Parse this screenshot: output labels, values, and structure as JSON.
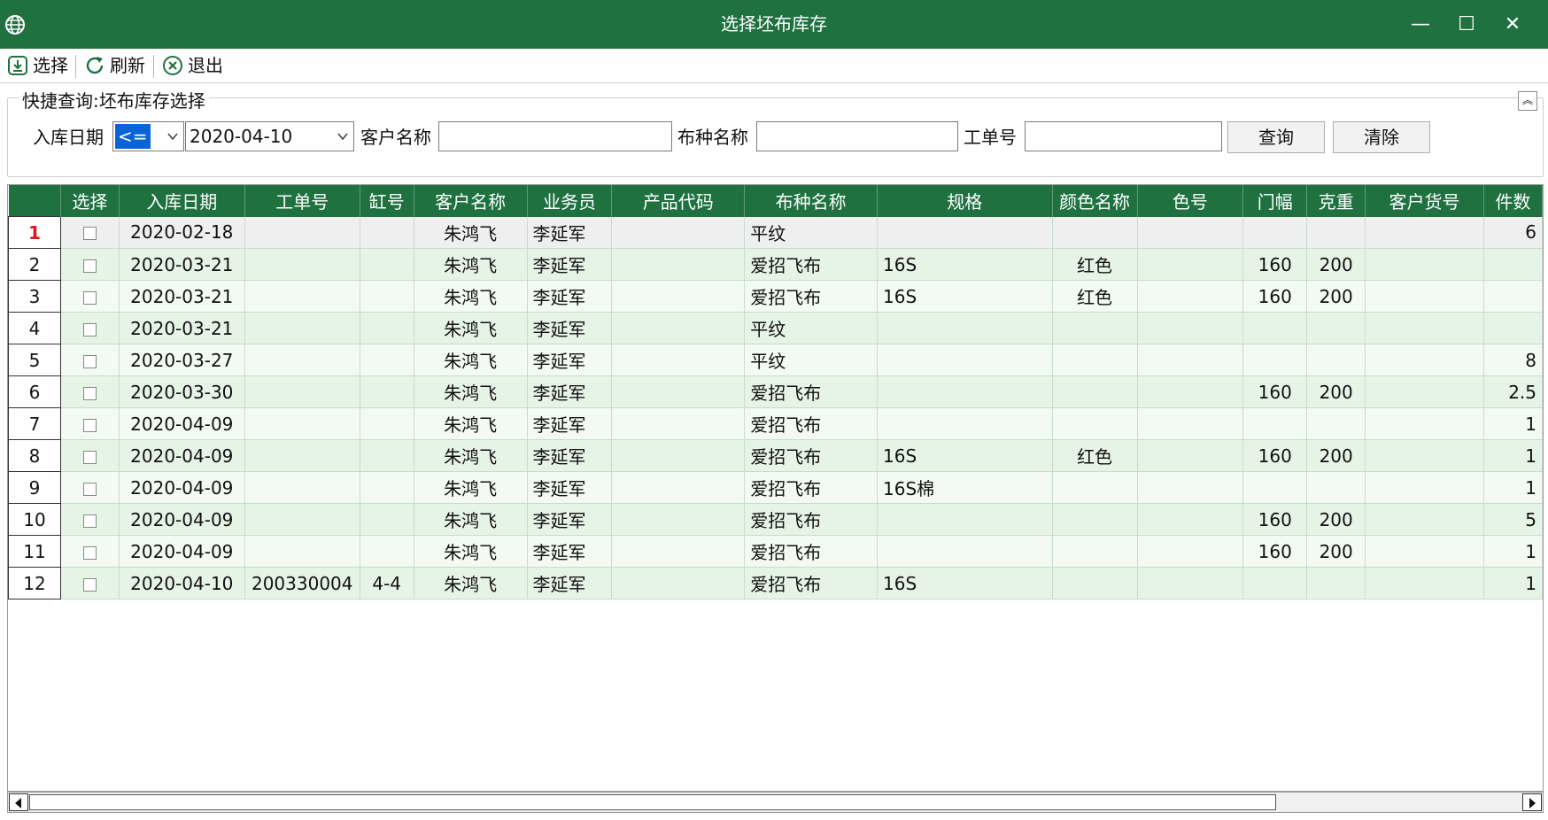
{
  "window": {
    "title": "选择坯布库存",
    "minimize": "—",
    "maximize": "☐",
    "close": "✕"
  },
  "toolbar": {
    "select_label": "选择",
    "refresh_label": "刷新",
    "exit_label": "退出"
  },
  "query": {
    "legend": "快捷查询:坯布库存选择",
    "date_label": "入库日期",
    "date_operator": "<=",
    "date_value": "2020-04-10",
    "customer_label": "客户名称",
    "customer_value": "",
    "fabric_label": "布种名称",
    "fabric_value": "",
    "order_label": "工单号",
    "order_value": "",
    "search_button": "查询",
    "clear_button": "清除"
  },
  "grid": {
    "columns": [
      "",
      "选择",
      "入库日期",
      "工单号",
      "缸号",
      "客户名称",
      "业务员",
      "产品代码",
      "布种名称",
      "规格",
      "颜色名称",
      "色号",
      "门幅",
      "克重",
      "客户货号",
      "件数"
    ],
    "rows": [
      {
        "no": "1",
        "date": "2020-02-18",
        "order": "",
        "vat": "",
        "customer": "朱鸿飞",
        "sales": "李延军",
        "code": "",
        "fabric": "平纹",
        "spec": "",
        "color": "",
        "colorno": "",
        "width": "",
        "weight": "",
        "custno": "",
        "pieces": "6"
      },
      {
        "no": "2",
        "date": "2020-03-21",
        "order": "",
        "vat": "",
        "customer": "朱鸿飞",
        "sales": "李延军",
        "code": "",
        "fabric": "爱招飞布",
        "spec": "16S",
        "color": "红色",
        "colorno": "",
        "width": "160",
        "weight": "200",
        "custno": "",
        "pieces": ""
      },
      {
        "no": "3",
        "date": "2020-03-21",
        "order": "",
        "vat": "",
        "customer": "朱鸿飞",
        "sales": "李延军",
        "code": "",
        "fabric": "爱招飞布",
        "spec": "16S",
        "color": "红色",
        "colorno": "",
        "width": "160",
        "weight": "200",
        "custno": "",
        "pieces": ""
      },
      {
        "no": "4",
        "date": "2020-03-21",
        "order": "",
        "vat": "",
        "customer": "朱鸿飞",
        "sales": "李延军",
        "code": "",
        "fabric": "平纹",
        "spec": "",
        "color": "",
        "colorno": "",
        "width": "",
        "weight": "",
        "custno": "",
        "pieces": ""
      },
      {
        "no": "5",
        "date": "2020-03-27",
        "order": "",
        "vat": "",
        "customer": "朱鸿飞",
        "sales": "李延军",
        "code": "",
        "fabric": "平纹",
        "spec": "",
        "color": "",
        "colorno": "",
        "width": "",
        "weight": "",
        "custno": "",
        "pieces": "8"
      },
      {
        "no": "6",
        "date": "2020-03-30",
        "order": "",
        "vat": "",
        "customer": "朱鸿飞",
        "sales": "李延军",
        "code": "",
        "fabric": "爱招飞布",
        "spec": "",
        "color": "",
        "colorno": "",
        "width": "160",
        "weight": "200",
        "custno": "",
        "pieces": "2.5"
      },
      {
        "no": "7",
        "date": "2020-04-09",
        "order": "",
        "vat": "",
        "customer": "朱鸿飞",
        "sales": "李延军",
        "code": "",
        "fabric": "爱招飞布",
        "spec": "",
        "color": "",
        "colorno": "",
        "width": "",
        "weight": "",
        "custno": "",
        "pieces": "1"
      },
      {
        "no": "8",
        "date": "2020-04-09",
        "order": "",
        "vat": "",
        "customer": "朱鸿飞",
        "sales": "李延军",
        "code": "",
        "fabric": "爱招飞布",
        "spec": "16S",
        "color": "红色",
        "colorno": "",
        "width": "160",
        "weight": "200",
        "custno": "",
        "pieces": "1"
      },
      {
        "no": "9",
        "date": "2020-04-09",
        "order": "",
        "vat": "",
        "customer": "朱鸿飞",
        "sales": "李延军",
        "code": "",
        "fabric": "爱招飞布",
        "spec": "16S棉",
        "color": "",
        "colorno": "",
        "width": "",
        "weight": "",
        "custno": "",
        "pieces": "1"
      },
      {
        "no": "10",
        "date": "2020-04-09",
        "order": "",
        "vat": "",
        "customer": "朱鸿飞",
        "sales": "李延军",
        "code": "",
        "fabric": "爱招飞布",
        "spec": "",
        "color": "",
        "colorno": "",
        "width": "160",
        "weight": "200",
        "custno": "",
        "pieces": "5"
      },
      {
        "no": "11",
        "date": "2020-04-09",
        "order": "",
        "vat": "",
        "customer": "朱鸿飞",
        "sales": "李延军",
        "code": "",
        "fabric": "爱招飞布",
        "spec": "",
        "color": "",
        "colorno": "",
        "width": "160",
        "weight": "200",
        "custno": "",
        "pieces": "1"
      },
      {
        "no": "12",
        "date": "2020-04-10",
        "order": "200330004",
        "vat": "4-4",
        "customer": "朱鸿飞",
        "sales": "李延军",
        "code": "",
        "fabric": "爱招飞布",
        "spec": "16S",
        "color": "",
        "colorno": "",
        "width": "",
        "weight": "",
        "custno": "",
        "pieces": "1"
      }
    ]
  },
  "colors": {
    "accent": "#1f7140",
    "current_row_number": "#e0141e"
  }
}
